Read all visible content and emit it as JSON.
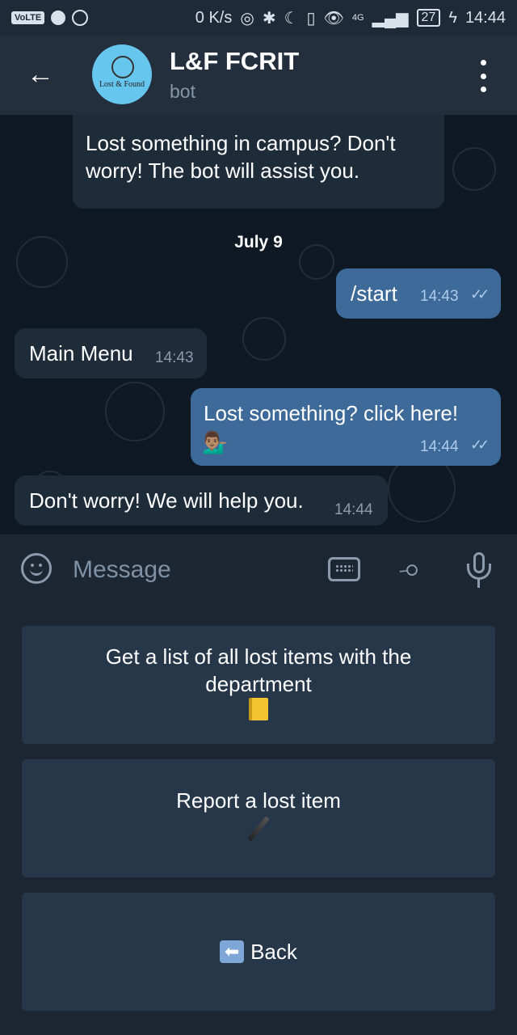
{
  "status_bar": {
    "volte": "VoLTE",
    "network_speed": "0 K/s",
    "network_type": "4G",
    "battery": "27",
    "time": "14:44"
  },
  "header": {
    "back_icon": "arrow-left-icon",
    "avatar_text": "Lost & Found",
    "title": "L&F FCRIT",
    "subtitle": "bot",
    "menu_icon": "more-vertical-icon"
  },
  "chat": {
    "messages": [
      {
        "direction": "in",
        "text": "Lost something in campus? Don't worry! The bot will assist you.",
        "time": ""
      },
      {
        "direction": "out",
        "text": "/start",
        "time": "14:43",
        "status": "read"
      },
      {
        "direction": "in",
        "text": "Main Menu",
        "time": "14:43"
      },
      {
        "direction": "out",
        "text": "Lost something? click here!",
        "emoji": "💁🏽‍♂️",
        "time": "14:44",
        "status": "read"
      },
      {
        "direction": "in",
        "text": "Don't worry! We will help you.",
        "time": "14:44"
      }
    ],
    "date_separator": "July 9"
  },
  "input": {
    "placeholder": "Message",
    "emoji_icon": "smile-icon",
    "keyboard_icon": "keyboard-icon",
    "attach_icon": "paperclip-icon",
    "mic_icon": "microphone-icon"
  },
  "keyboard_buttons": [
    {
      "label": "Get a list of all lost items with the department",
      "emoji": "notebook"
    },
    {
      "label": "Report a lost item",
      "emoji": "pen"
    },
    {
      "label": "Back",
      "emoji": "back-arrow"
    }
  ],
  "colors": {
    "header_bg": "#242f3d",
    "chat_bg": "#0f1923",
    "bubble_in": "#1e2c3a",
    "bubble_out": "#3d6a99",
    "keyboard_button": "#27374a"
  }
}
